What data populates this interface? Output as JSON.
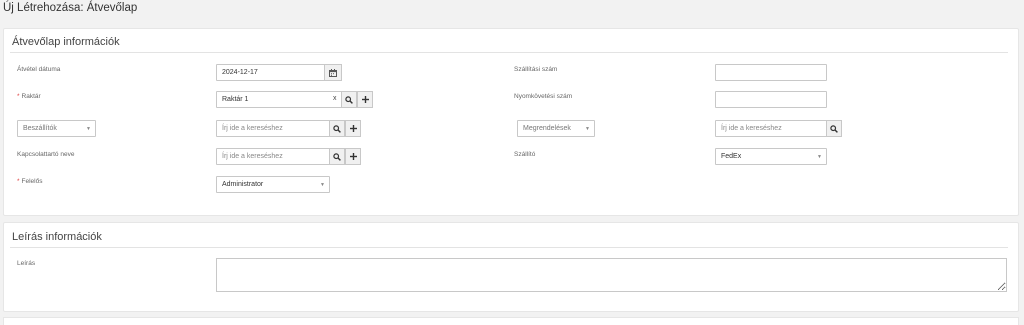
{
  "page": {
    "title": "Új Létrehozása: Átvevőlap"
  },
  "receipt_section": {
    "title": "Átvevőlap információk",
    "receipt_date": {
      "label": "Átvétel dátuma",
      "value": "2024-12-17"
    },
    "warehouse": {
      "label": "Raktár",
      "value": "Raktár 1",
      "clear": "x"
    },
    "suppliers": {
      "selected": "Beszállítók",
      "search_placeholder": "Írj ide a kereséshez"
    },
    "contact_name": {
      "label": "Kapcsolattartó neve",
      "search_placeholder": "Írj ide a kereséshez"
    },
    "responsible": {
      "label": "Felelős",
      "selected": "Administrator"
    },
    "shipping_number": {
      "label": "Szállítási szám",
      "value": ""
    },
    "tracking_number": {
      "label": "Nyomkövetési szám",
      "value": ""
    },
    "orders": {
      "selected": "Megrendelések",
      "search_placeholder": "Írj ide a kereséshez"
    },
    "carrier": {
      "label": "Szállító",
      "selected": "FedEx"
    }
  },
  "description_section": {
    "title": "Leírás információk",
    "description": {
      "label": "Leírás",
      "value": ""
    }
  },
  "icons": {
    "calendar": "calendar-icon",
    "search": "search-icon",
    "plus": "plus-icon",
    "caret": "caret-down-icon"
  },
  "colors": {
    "required": "#e04040",
    "border": "#c8c8c8",
    "background": "#f2f2f2"
  }
}
